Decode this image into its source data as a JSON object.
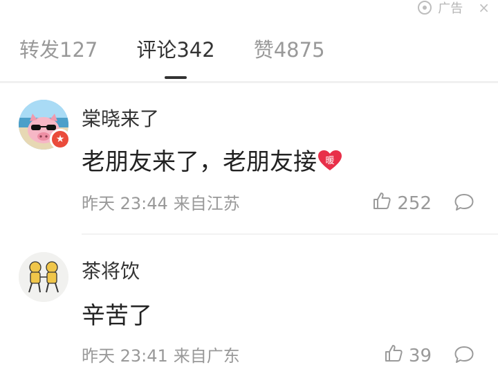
{
  "ad": {
    "label": "广告",
    "close": "×"
  },
  "tabs": [
    {
      "label": "转发127"
    },
    {
      "label": "评论342"
    },
    {
      "label": "赞4875"
    }
  ],
  "comments": [
    {
      "username": "棠晓来了",
      "text": "老朋友来了，老朋友接",
      "emoji_text": "暖",
      "time": "昨天 23:44",
      "location": "来自江苏",
      "likes": "252",
      "badge_icon": "star-icon"
    },
    {
      "username": "茶将饮",
      "text": "辛苦了",
      "time": "昨天 23:41",
      "location": "来自广东",
      "likes": "39"
    }
  ]
}
